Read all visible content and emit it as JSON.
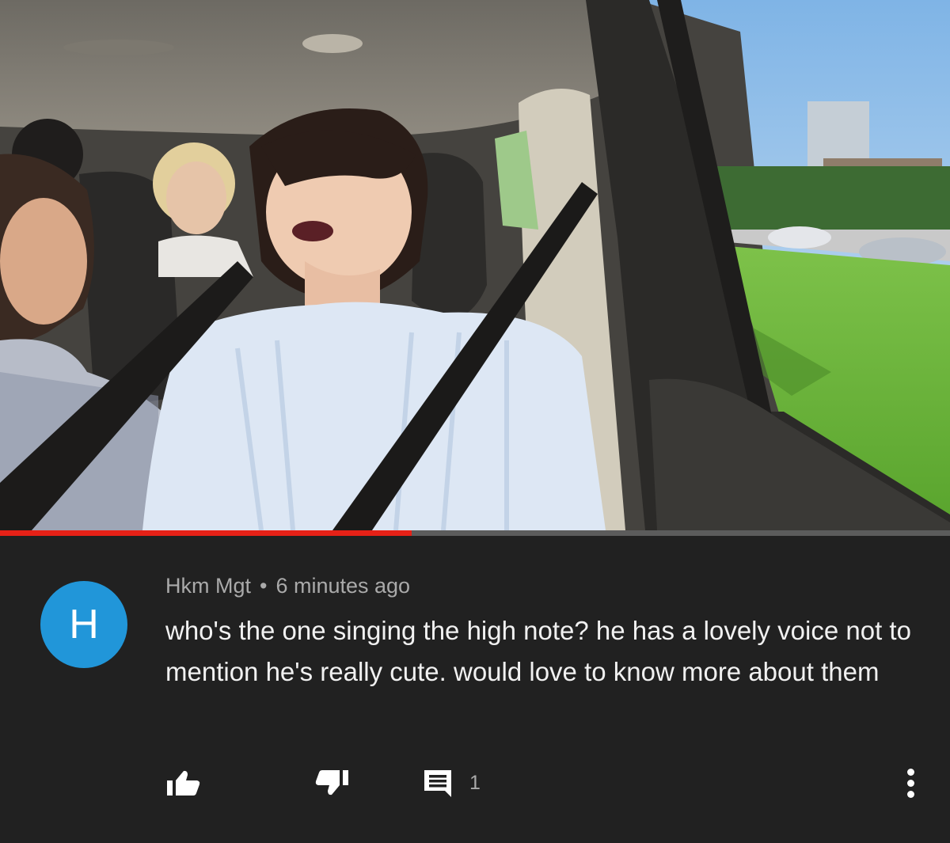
{
  "video": {
    "progress_fraction": 0.433,
    "colors": {
      "progress_played": "#e62117",
      "progress_track": "#5c5c5c"
    }
  },
  "comment": {
    "avatar_initial": "H",
    "avatar_color": "#2196d9",
    "author": "Hkm Mgt",
    "separator": "•",
    "timestamp": "6 minutes ago",
    "text": "who's the one singing the high note? he has a lovely voice not to mention he's really cute. would love to know more about them",
    "actions": {
      "like_icon": "thumbs-up-icon",
      "dislike_icon": "thumbs-down-icon",
      "reply_icon": "reply-comment-icon",
      "reply_count": "1",
      "more_icon": "more-vertical-icon"
    }
  }
}
